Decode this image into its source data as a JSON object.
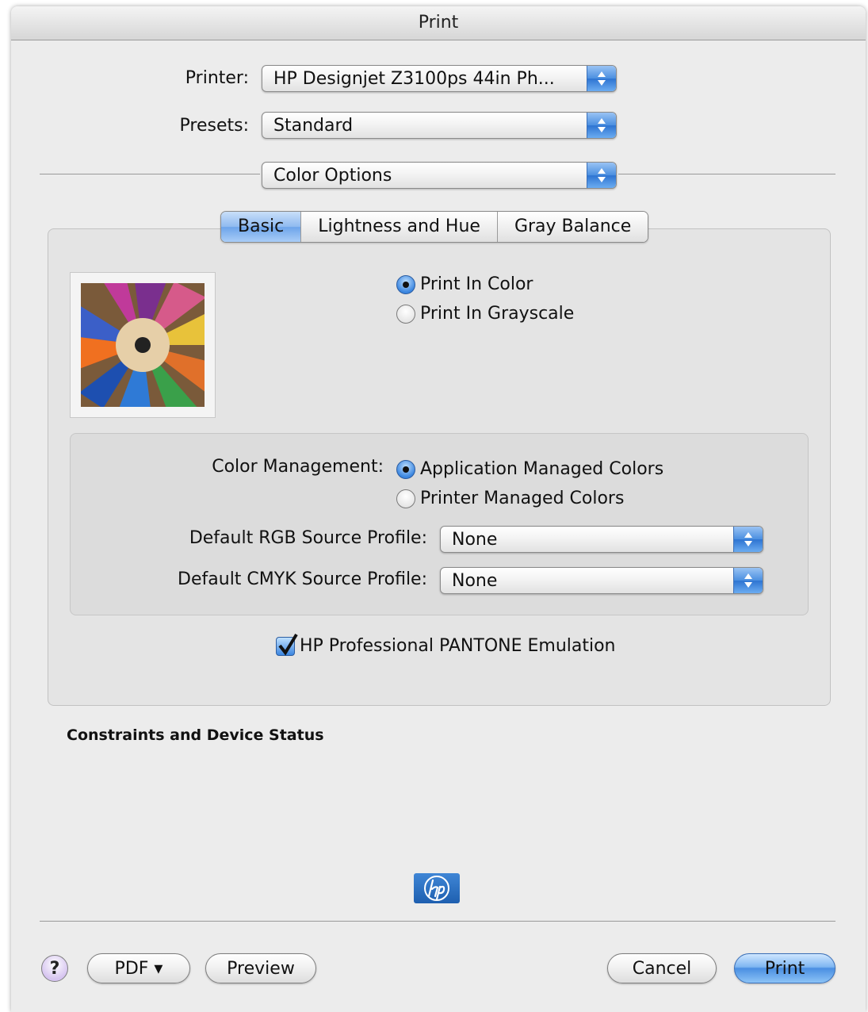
{
  "window": {
    "title": "Print"
  },
  "printer": {
    "label": "Printer:",
    "value": "HP Designjet Z3100ps 44in Ph..."
  },
  "presets": {
    "label": "Presets:",
    "value": "Standard"
  },
  "panel": {
    "value": "Color Options"
  },
  "tabs": [
    {
      "label": "Basic",
      "selected": true
    },
    {
      "label": "Lightness and Hue",
      "selected": false
    },
    {
      "label": "Gray Balance",
      "selected": false
    }
  ],
  "preview_image": {
    "icon": "colored-pencils-image"
  },
  "color_mode": {
    "options": [
      {
        "label": "Print In Color",
        "selected": true
      },
      {
        "label": "Print In Grayscale",
        "selected": false
      }
    ]
  },
  "color_management": {
    "label": "Color Management:",
    "options": [
      {
        "label": "Application Managed Colors",
        "selected": true
      },
      {
        "label": "Printer Managed Colors",
        "selected": false
      }
    ],
    "rgb_profile": {
      "label": "Default RGB Source Profile:",
      "value": "None"
    },
    "cmyk_profile": {
      "label": "Default CMYK Source Profile:",
      "value": "None"
    }
  },
  "pantone": {
    "label": "HP Professional PANTONE Emulation",
    "checked": true
  },
  "status": {
    "heading": "Constraints and Device Status"
  },
  "footer": {
    "help_label": "?",
    "pdf_label": "PDF ▾",
    "preview_label": "Preview",
    "cancel_label": "Cancel",
    "print_label": "Print"
  },
  "colors": {
    "accent": "#4a8fe2",
    "window_bg": "#ececec",
    "hp_logo": "#1e5fb0"
  }
}
